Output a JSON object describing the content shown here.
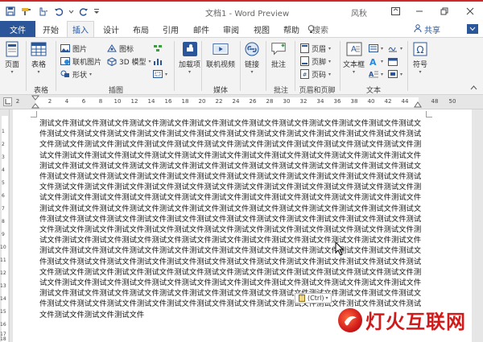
{
  "window": {
    "title": "文档1 - Word Preview",
    "user": "风秋"
  },
  "tabs": {
    "file": "文件",
    "items": [
      "开始",
      "插入",
      "设计",
      "布局",
      "引用",
      "邮件",
      "审阅",
      "视图",
      "帮助"
    ],
    "active": "插入",
    "search_placeholder": "搜索",
    "share": "共享"
  },
  "ribbon": {
    "pages": {
      "label": "页面"
    },
    "table": {
      "label": "表格",
      "group": "表格"
    },
    "illustrations": {
      "group": "插图",
      "picture": "图片",
      "online_picture": "联机图片",
      "shapes": "形状",
      "icons": "图标",
      "model_3d": "3D 模型"
    },
    "addins": {
      "label": "加载项"
    },
    "media": {
      "group": "媒体",
      "online_video": "联机视频"
    },
    "links": {
      "label": "链接"
    },
    "comments": {
      "group": "批注",
      "comment": "批注"
    },
    "header_footer": {
      "group": "页眉和页脚",
      "header": "页眉",
      "footer": "页脚",
      "page_number": "页码"
    },
    "text": {
      "group": "文本",
      "textbox": "文本框"
    },
    "symbols": {
      "label": "符号"
    }
  },
  "ruler": {
    "numbers": [
      "2",
      "2",
      "4",
      "6",
      "8",
      "10",
      "12",
      "14",
      "16",
      "18",
      "20",
      "22",
      "24",
      "26",
      "28",
      "30",
      "32",
      "34",
      "36",
      "38",
      "40",
      "42",
      "44",
      "48",
      "50"
    ],
    "vnumbers": [
      "1",
      "2",
      "3",
      "4",
      "5",
      "6",
      "7",
      "8",
      "9",
      "10",
      "11",
      "12",
      "13",
      "14",
      "15",
      "16",
      "17",
      "18"
    ]
  },
  "document": {
    "body": "测试文件测试文件测试文件测试文件测试文件测试文件测试文件测试文件测试文件测试文件测试文件测试文件测试文件测试文件测试文件测试文件测试文件测试文件测试文件测试文件测试文件测试文件测试文件测试文件测试文件测试文件测试文件测试文件测试文件测试文件测试文件测试文件测试文件测试文件测试文件测试文件测试文件测试文件测试文件测试文件测试文件测试文件测试文件测试文件测试文件测试文件测试文件测试文件测试文件测试文件测试文件测试文件测试文件测试文件测试文件测试文件测试文件测试文件测试文件测试文件测试文件测试文件测试文件测试文件测试文件测试文件测试文件测试文件测试文件测试文件测试文件测试文件测试文件测试文件测试文件测试文件测试文件测试文件测试文件测试文件测试文件测试文件测试文件测试文件测试文件测试文件测试文件测试文件测试文件测试文件测试文件测试文件测试文件测试文件测试文件测试文件测试文件测试文件测试文件测试文件测试文件测试文件测试文件测试文件测试文件测试文件测试文件测试文件测试文件测试文件测试文件测试文件测试文件测试文件测试文件测试文件测试文件测试文件测试文件测试文件测试文件测试文件测试文件测试文件测试文件测试文件测试文件测试文件测试文件测试文件测试文件测试文件测试文件测试文件测试文件测试文件测试文件测试文件测试文件测试文件测试文件测试文件测试文件测试文件测试文件测试文件测试文件测试文件测试文件测试文件测试文件测试文件测试文件测试文件测试文件测试文件测试文件测试文件测试文件测试文件测试文件测试文件测试文件测试文件测试文件测试文件测试文件测试文件测试文件测试文件测试文件测试文件测试文件测试文件测试文件测试文件测试文件测试文件测试文件测试文件测试文件测试文件测试文件测试文件测试文件测试文件测试文件测试文件测试文件测试文件测试文件测试文件测试文件测试文件测试文件测试文件测试文件测试文件测试文件测试文件测试文件测试文件测试文件测试文件测试文件测试文件测试文件测试文件测试文件测试文件测试文件测试文件测试文件测试文件测试文件测试文件测试文件测试文件测试文件测试文件测试文件测试文件测试文件测试文件测试文件测试文件测试文件测试文件测试文件测试文件测试文件测试文件测试文件"
  },
  "paste_options": {
    "label": "(Ctrl)"
  },
  "watermark": {
    "text": "灯火互联网"
  },
  "colors": {
    "accent": "#2b579a",
    "title_border": "#cc2b2b",
    "watermark": "#d11b1b"
  }
}
